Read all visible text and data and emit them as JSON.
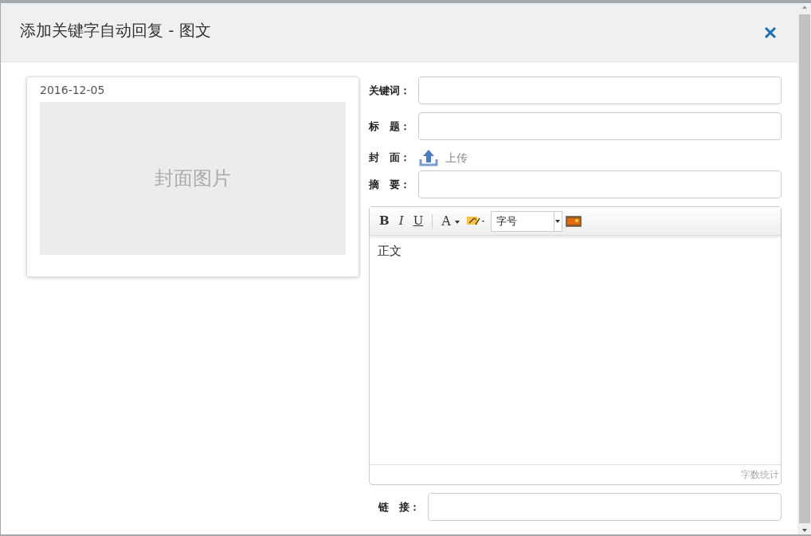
{
  "dialog": {
    "title": "添加关键字自动回复 - 图文"
  },
  "preview": {
    "date": "2016-12-05",
    "cover_text": "封面图片"
  },
  "fields": [
    {
      "kind": "input",
      "label": "关键词："
    },
    {
      "kind": "input",
      "label": "标　题："
    },
    {
      "kind": "upload",
      "label": "封　面：",
      "action": "上传"
    },
    {
      "kind": "input",
      "label": "摘　要："
    }
  ],
  "editor": {
    "toolbar": [
      {
        "kind": "bold",
        "label": "B"
      },
      {
        "kind": "italic",
        "label": "I"
      },
      {
        "kind": "underline",
        "label": "U"
      },
      {
        "kind": "sep"
      },
      {
        "kind": "color",
        "label": "A"
      },
      {
        "kind": "highlight"
      },
      {
        "kind": "select",
        "label": "字号"
      },
      {
        "kind": "image"
      }
    ],
    "body": "正文",
    "word_count": "字数统计"
  },
  "link_field": {
    "label": "链　接："
  }
}
